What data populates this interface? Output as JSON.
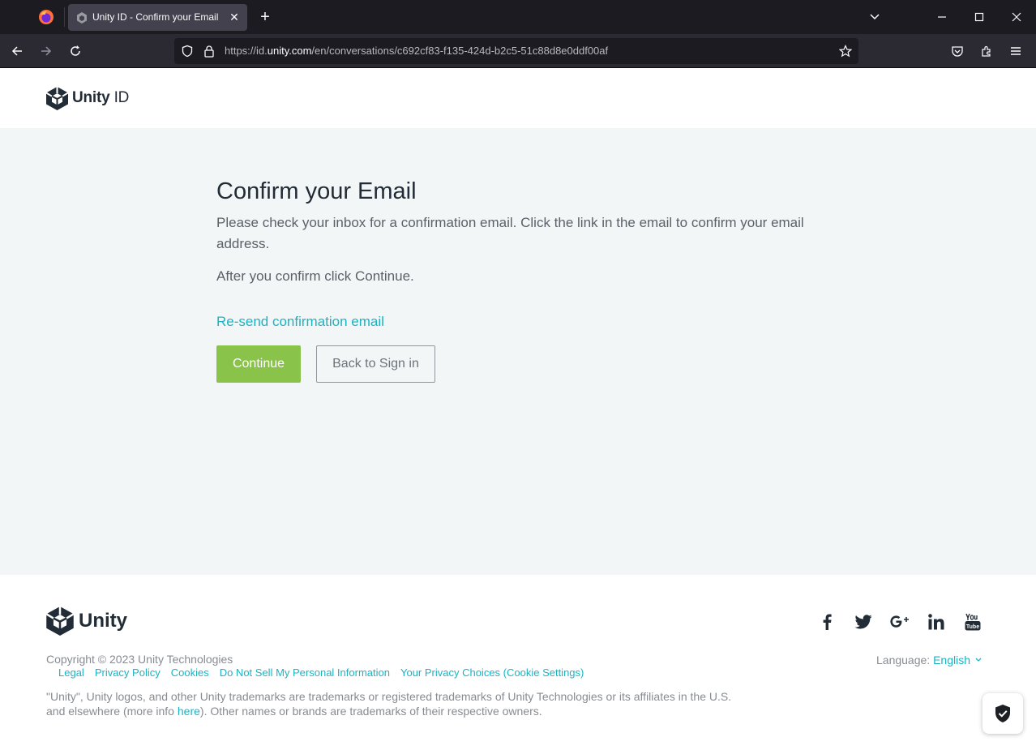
{
  "browser": {
    "tab_title": "Unity ID - Confirm your Email",
    "new_tab_label": "+",
    "url_prefix": "https://id.",
    "url_domain": "unity.com",
    "url_path": "/en/conversations/c692cf83-f135-424d-b2c5-51c88d8e0ddf00af"
  },
  "header": {
    "logo_bold": "Unity",
    "logo_light": " ID"
  },
  "main": {
    "heading": "Confirm your Email",
    "paragraph": "Please check your inbox for a confirmation email. Click the link in the email to confirm your email address.",
    "paragraph2": "After you confirm click Continue.",
    "resend_link": "Re-send confirmation email",
    "continue_button": "Continue",
    "back_button": "Back to Sign in"
  },
  "footer": {
    "logo_text": "Unity",
    "copyright": "Copyright © 2023 Unity Technologies",
    "links": [
      "Legal",
      "Privacy Policy",
      "Cookies",
      "Do Not Sell My Personal Information",
      "Your Privacy Choices (Cookie Settings)"
    ],
    "disclaimer_before": "\"Unity\", Unity logos, and other Unity trademarks are trademarks or registered trademarks of Unity Technologies or its affiliates in the U.S. and elsewhere (more info ",
    "disclaimer_link": "here",
    "disclaimer_after": "). Other names or brands are trademarks of their respective owners.",
    "language_label": "Language: ",
    "language_value": "English",
    "social_icons": [
      "facebook-icon",
      "twitter-icon",
      "google-plus-icon",
      "linkedin-icon",
      "youtube-icon"
    ]
  },
  "colors": {
    "accent": "#19b4c4",
    "continue_green": "#8ac349",
    "heading_text": "#222c37",
    "main_bg": "#f3f6f7"
  }
}
